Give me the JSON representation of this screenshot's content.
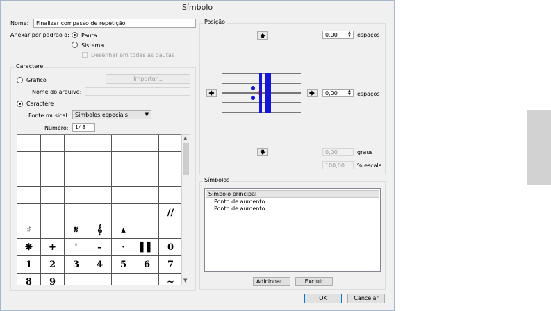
{
  "title": "Símbolo",
  "name_label": "Nome:",
  "name_value": "Finalizar compasso de repetição",
  "attach_label": "Anexar por padrão a:",
  "attach_options": [
    "Pauta",
    "Sistema"
  ],
  "draw_all_staves": "Desenhar em todas as pautas",
  "caractere_group": "Caractere",
  "grafico_label": "Gráfico",
  "import_button": "Importar...",
  "filename_label": "Nome do arquivo:",
  "caractere_option": "Caractere",
  "font_label": "Fonte musical:",
  "font_value": "Símbolos especiais",
  "number_label": "Número:",
  "number_value": "148",
  "glyph_grid": [
    [
      "",
      "",
      "",
      "",
      "",
      "",
      ""
    ],
    [
      "",
      "",
      "",
      "",
      "",
      "",
      ""
    ],
    [
      "",
      "",
      "",
      "",
      "",
      "",
      ""
    ],
    [
      "",
      "",
      "",
      "",
      "",
      "",
      ""
    ],
    [
      "",
      "",
      "",
      "",
      "",
      "",
      "//"
    ],
    [
      "♯",
      "",
      "𝄋",
      "𝄞",
      "▴",
      "",
      ""
    ],
    [
      "❋",
      "+",
      "'",
      "–",
      "·",
      "▌▌",
      "0"
    ],
    [
      "1",
      "2",
      "3",
      "4",
      "5",
      "6",
      "7"
    ],
    [
      "8",
      "9",
      "",
      "",
      "",
      "",
      "~"
    ]
  ],
  "position_group": "Posição",
  "top_value": "0,00",
  "spaces_label": "espaços",
  "right_value": "0,00",
  "rotation_value": "0,00",
  "degrees_label": "graus",
  "scale_value": "100,00",
  "scale_label": "% escala",
  "symbols_group": "Símbolos",
  "symbols_list": [
    "Símbolo principal",
    "Ponto de aumento",
    "Ponto de aumento"
  ],
  "add_button": "Adicionar...",
  "delete_button": "Excluir",
  "ok_button": "OK",
  "cancel_button": "Cancelar",
  "colors": {
    "accent": "#0078d7",
    "preview_blue": "#1515d6",
    "origin_red": "#cc0000"
  }
}
